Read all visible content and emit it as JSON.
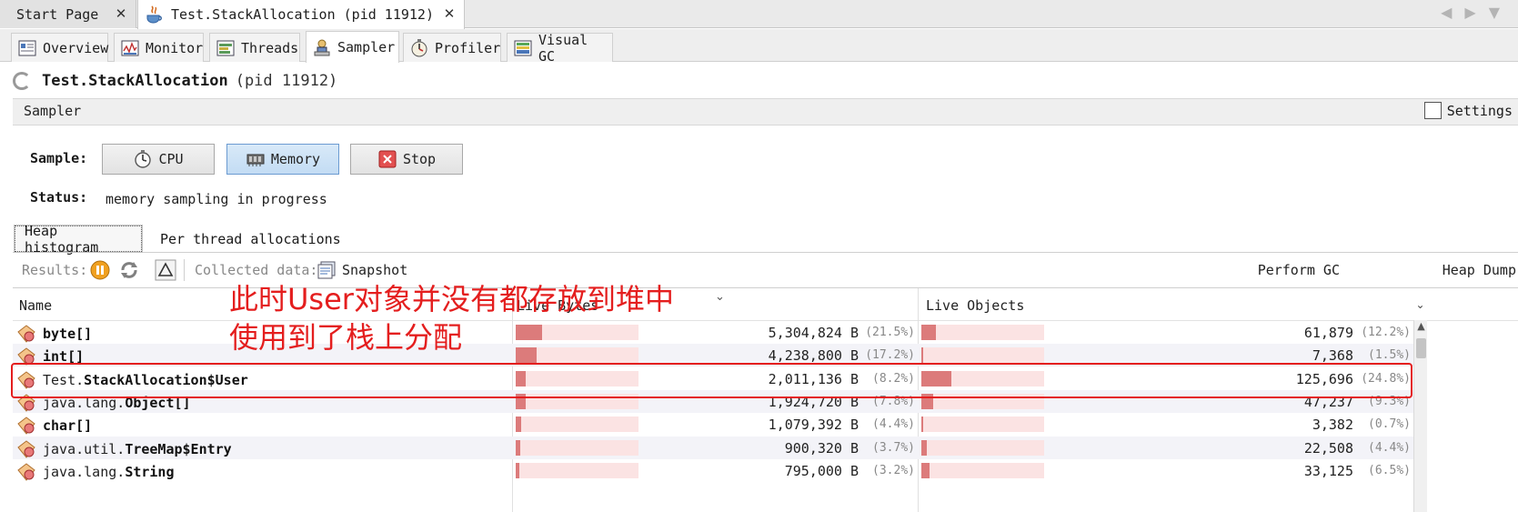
{
  "doc_tabs": [
    {
      "label": "Start Page"
    },
    {
      "label": "Test.StackAllocation (pid 11912)"
    }
  ],
  "sub_tabs": [
    {
      "label": "Overview",
      "icon": "overview-icon"
    },
    {
      "label": "Monitor",
      "icon": "monitor-icon"
    },
    {
      "label": "Threads",
      "icon": "threads-icon"
    },
    {
      "label": "Sampler",
      "icon": "sampler-icon",
      "active": true
    },
    {
      "label": "Profiler",
      "icon": "profiler-icon"
    },
    {
      "label": "Visual GC",
      "icon": "visual-gc-icon"
    }
  ],
  "header": {
    "app_name": "Test.StackAllocation",
    "pid": "(pid 11912)"
  },
  "sampler": {
    "section_label": "Sampler",
    "settings_label": "Settings"
  },
  "controls": {
    "sample_label": "Sample:",
    "cpu_label": "CPU",
    "memory_label": "Memory",
    "stop_label": "Stop",
    "status_label": "Status:",
    "status_value": "memory sampling in progress"
  },
  "inner_tabs": [
    {
      "label": "Heap histogram",
      "active": true
    },
    {
      "label": "Per thread allocations"
    }
  ],
  "results": {
    "results_label": "Results:",
    "collected_label": "Collected data:",
    "snapshot_label": "Snapshot",
    "perform_gc_label": "Perform GC",
    "heap_dump_label": "Heap Dump"
  },
  "table": {
    "columns": [
      "Name",
      "Live Bytes",
      "Live Objects"
    ],
    "rows": [
      {
        "pkg": "",
        "cls": "byte[]",
        "bytes": "5,304,824 B",
        "bytes_pct": "(21.5%)",
        "bytes_frac": 0.215,
        "objects": "61,879",
        "objects_pct": "(12.2%)",
        "objects_frac": 0.122
      },
      {
        "pkg": "",
        "cls": "int[]",
        "bytes": "4,238,800 B",
        "bytes_pct": "(17.2%)",
        "bytes_frac": 0.172,
        "objects": "7,368",
        "objects_pct": "(1.5%)",
        "objects_frac": 0.015
      },
      {
        "pkg": "Test.",
        "cls": "StackAllocation$User",
        "bytes": "2,011,136 B",
        "bytes_pct": "(8.2%)",
        "bytes_frac": 0.082,
        "objects": "125,696",
        "objects_pct": "(24.8%)",
        "objects_frac": 0.248
      },
      {
        "pkg": "java.lang.",
        "cls": "Object[]",
        "bytes": "1,924,720 B",
        "bytes_pct": "(7.8%)",
        "bytes_frac": 0.078,
        "objects": "47,237",
        "objects_pct": "(9.3%)",
        "objects_frac": 0.093
      },
      {
        "pkg": "",
        "cls": "char[]",
        "bytes": "1,079,392 B",
        "bytes_pct": "(4.4%)",
        "bytes_frac": 0.044,
        "objects": "3,382",
        "objects_pct": "(0.7%)",
        "objects_frac": 0.007
      },
      {
        "pkg": "java.util.",
        "cls": "TreeMap$Entry",
        "bytes": "900,320 B",
        "bytes_pct": "(3.7%)",
        "bytes_frac": 0.037,
        "objects": "22,508",
        "objects_pct": "(4.4%)",
        "objects_frac": 0.044
      },
      {
        "pkg": "java.lang.",
        "cls": "String",
        "bytes": "795,000 B",
        "bytes_pct": "(3.2%)",
        "bytes_frac": 0.032,
        "objects": "33,125",
        "objects_pct": "(6.5%)",
        "objects_frac": 0.065
      }
    ]
  },
  "annotation": {
    "line1": "此时User对象并没有都存放到堆中",
    "line2": "使用到了栈上分配",
    "color": "#e41e1e"
  }
}
